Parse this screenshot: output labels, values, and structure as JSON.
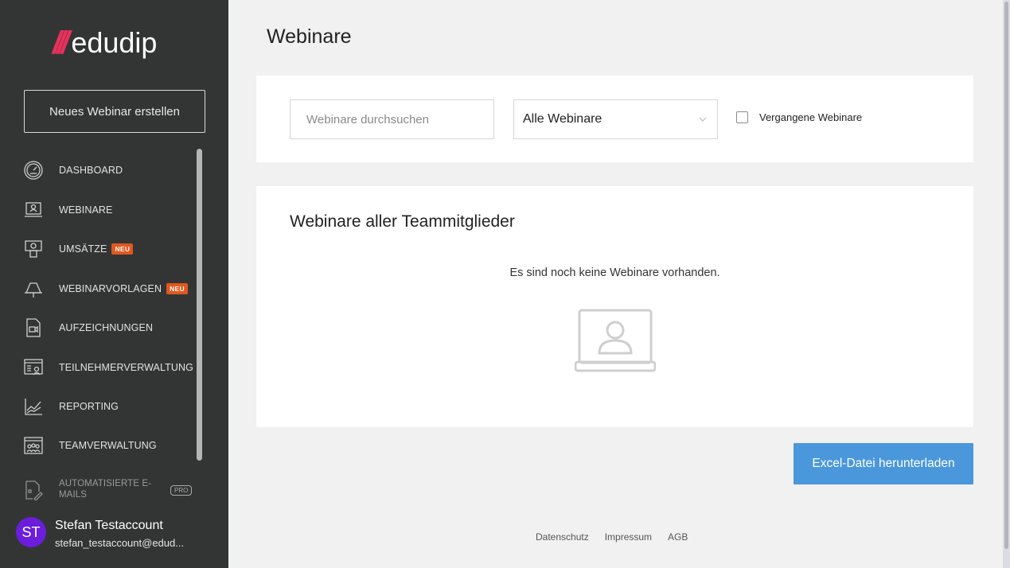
{
  "sidebar": {
    "logo_slashes": "///",
    "logo_text": "edudip",
    "new_button": "Neues Webinar erstellen",
    "items": [
      {
        "label": "DASHBOARD",
        "icon": "dashboard-icon"
      },
      {
        "label": "WEBINARE",
        "icon": "webinar-laptop-icon"
      },
      {
        "label": "UMSÄTZE",
        "icon": "revenue-icon",
        "badge": "NEU"
      },
      {
        "label": "WEBINARVORLAGEN",
        "icon": "template-icon",
        "badge": "NEU"
      },
      {
        "label": "AUFZEICHNUNGEN",
        "icon": "recording-icon"
      },
      {
        "label": "TEILNEHMERVERWALTUNG",
        "icon": "participants-icon"
      },
      {
        "label": "REPORTING",
        "icon": "reporting-icon"
      },
      {
        "label": "TEAMVERWALTUNG",
        "icon": "team-icon"
      },
      {
        "label": "AUTOMATISIERTE E-MAILS",
        "icon": "email-automation-icon",
        "badge": "PRO"
      }
    ],
    "user": {
      "initials": "ST",
      "name": "Stefan Testaccount",
      "email": "stefan_testaccount@edud..."
    }
  },
  "main": {
    "title": "Webinare",
    "filters": {
      "search_placeholder": "Webinare durchsuchen",
      "select_value": "Alle Webinare",
      "checkbox_label": "Vergangene Webinare",
      "checkbox_checked": false
    },
    "list": {
      "title": "Webinare aller Teammitglieder",
      "empty_text": "Es sind noch keine Webinare vorhanden."
    },
    "excel_button": "Excel-Datei herunterladen"
  },
  "footer": {
    "links": [
      "Datenschutz",
      "Impressum",
      "AGB"
    ]
  },
  "colors": {
    "sidebar_bg": "#333535",
    "accent_blue": "#4a97dc",
    "badge_orange": "#e2571d",
    "logo_red": "#e8315b",
    "avatar_purple": "#6b1ddb"
  }
}
